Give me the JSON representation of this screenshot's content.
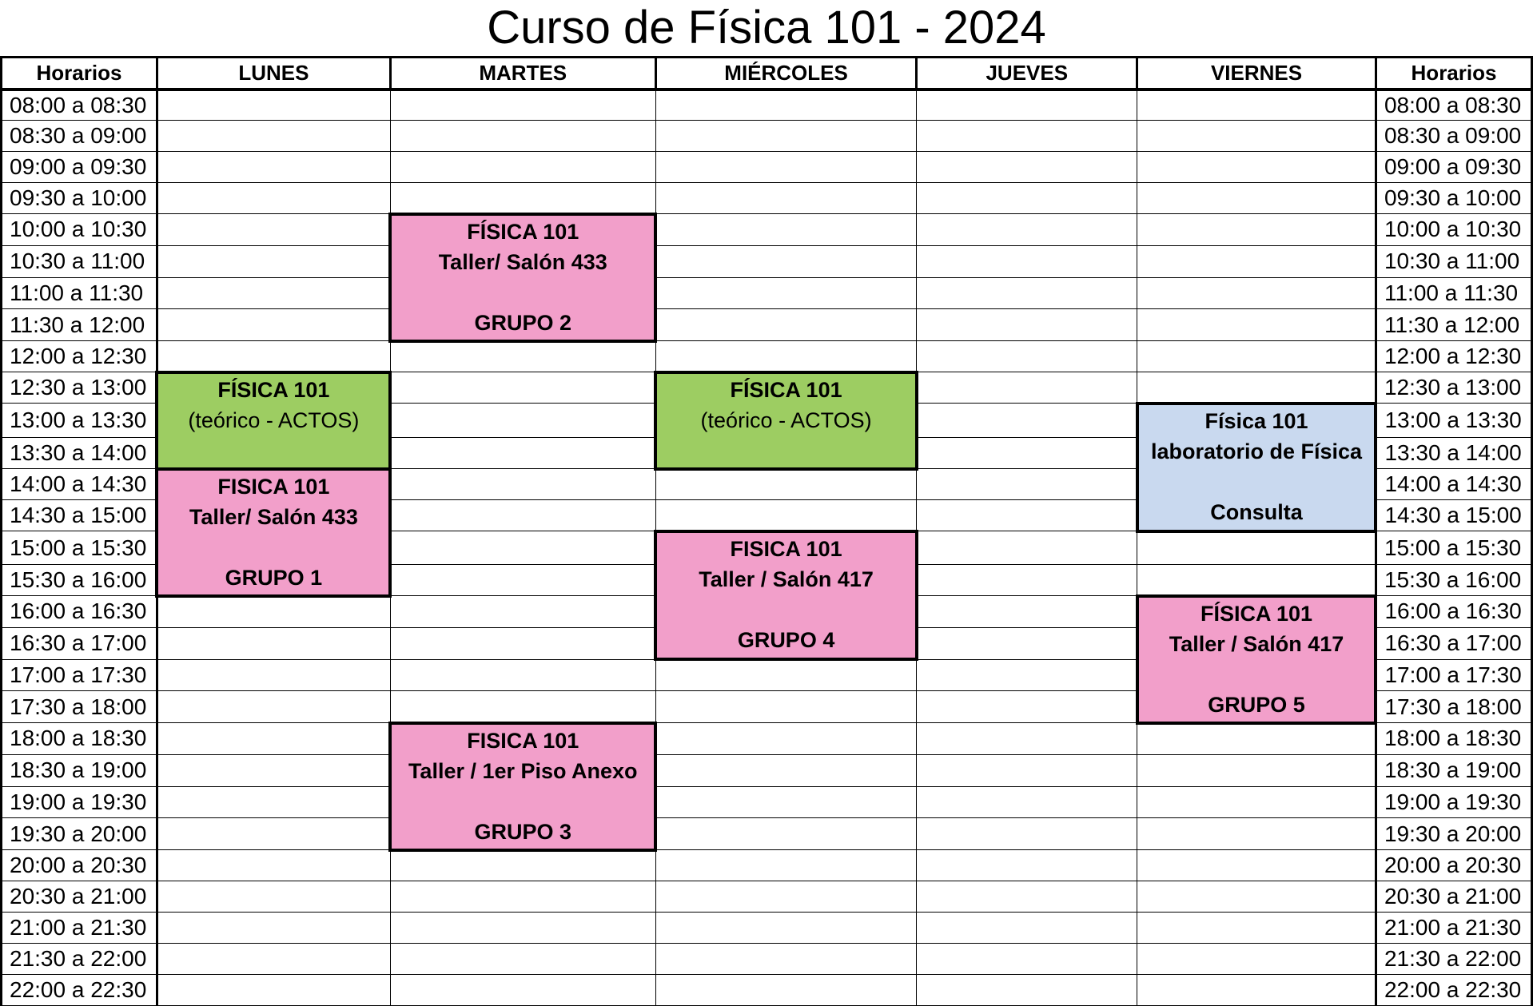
{
  "title": "Curso de Física 101 - 2024",
  "headers": [
    "Horarios",
    "LUNES",
    "MARTES",
    "MIÉRCOLES",
    "JUEVES",
    "VIERNES",
    "Horarios"
  ],
  "slots": [
    "08:00 a 08:30",
    "08:30 a 09:00",
    "09:00 a 09:30",
    "09:30 a 10:00",
    "10:00 a 10:30",
    "10:30 a 11:00",
    "11:00 a 11:30",
    "11:30 a 12:00",
    "12:00 a 12:30",
    "12:30 a 13:00",
    "13:00 a 13:30",
    "13:30 a 14:00",
    "14:00 a 14:30",
    "14:30 a 15:00",
    "15:00 a 15:30",
    "15:30 a 16:00",
    "16:00 a 16:30",
    "16:30 a 17:00",
    "17:00 a 17:30",
    "17:30 a 18:00",
    "18:00 a 18:30",
    "18:30 a 19:00",
    "19:00 a 19:30",
    "19:30 a 20:00",
    "20:00 a 20:30",
    "20:30 a 21:00",
    "21:00 a 21:30",
    "21:30 a 22:00",
    "22:00 a 22:30"
  ],
  "colors": {
    "taller": "#f29fca",
    "teorico": "#9dcd62",
    "laboratorio": "#c9d9ef",
    "border": "#000000"
  },
  "blocks": [
    {
      "id": "lunes-teorico",
      "day": 1,
      "start": 9,
      "span": 3,
      "kind": "teorico",
      "lines": [
        "FÍSICA 101",
        "(teórico - ACTOS)",
        "",
        ""
      ]
    },
    {
      "id": "lunes-grupo-1",
      "day": 1,
      "start": 12,
      "span": 4,
      "kind": "taller",
      "lines": [
        "FISICA 101",
        "Taller/ Salón 433",
        "",
        "GRUPO 1"
      ]
    },
    {
      "id": "martes-grupo-2",
      "day": 2,
      "start": 4,
      "span": 4,
      "kind": "taller",
      "lines": [
        "FÍSICA 101",
        "Taller/ Salón 433",
        "",
        "GRUPO 2"
      ]
    },
    {
      "id": "martes-grupo-3",
      "day": 2,
      "start": 20,
      "span": 4,
      "kind": "taller",
      "lines": [
        "FISICA 101",
        "Taller / 1er Piso Anexo",
        "",
        "GRUPO 3"
      ]
    },
    {
      "id": "miercoles-teorico",
      "day": 3,
      "start": 9,
      "span": 3,
      "kind": "teorico",
      "lines": [
        "FÍSICA 101",
        "(teórico - ACTOS)",
        "",
        ""
      ]
    },
    {
      "id": "miercoles-grupo-4",
      "day": 3,
      "start": 14,
      "span": 4,
      "kind": "taller",
      "lines": [
        "FISICA 101",
        "Taller / Salón 417",
        "",
        "GRUPO 4"
      ]
    },
    {
      "id": "viernes-laboratorio",
      "day": 5,
      "start": 10,
      "span": 4,
      "kind": "laboratorio",
      "lines": [
        "Física 101",
        "laboratorio de Física",
        "",
        "Consulta"
      ]
    },
    {
      "id": "viernes-grupo-5",
      "day": 5,
      "start": 16,
      "span": 4,
      "kind": "taller",
      "lines": [
        "FÍSICA 101",
        "Taller / Salón 417",
        "",
        "GRUPO 5"
      ]
    }
  ]
}
